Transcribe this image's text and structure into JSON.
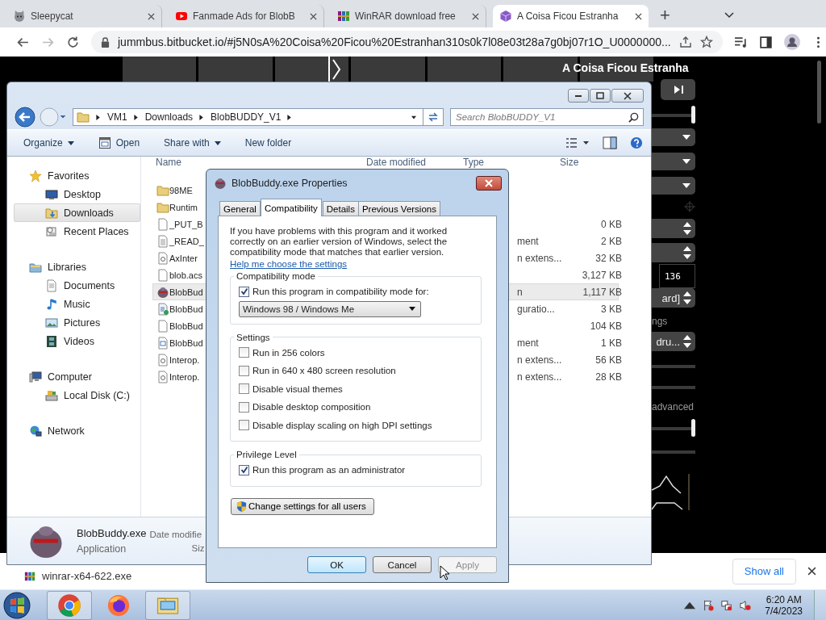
{
  "browser": {
    "tabs": [
      {
        "title": "Sleepycat",
        "kind": "cat",
        "selected": false
      },
      {
        "title": "Fanmade Ads for BlobB",
        "kind": "video",
        "selected": false
      },
      {
        "title": "WinRAR download free",
        "kind": "archive",
        "selected": false
      },
      {
        "title": "A Coisa Ficou Estranha",
        "kind": "cube",
        "selected": true
      }
    ],
    "new_tab": "+",
    "url": "jummbus.bitbucket.io/#j5N0sA%20Coisa%20Ficou%20Estranhan310s0k7l08e03t28a7g0bj07r1O_U0000000..."
  },
  "page": {
    "song_title": "A Coisa Ficou Estranha",
    "controls": [
      {
        "kind": "next-button"
      },
      {
        "kind": "slider",
        "level": 1
      },
      {
        "kind": "dropdown"
      },
      {
        "kind": "dropdown"
      },
      {
        "kind": "dropdown"
      },
      {
        "kind": "crosshair"
      },
      {
        "kind": "spinner"
      },
      {
        "kind": "spinner"
      },
      {
        "kind": "number",
        "value": "136"
      },
      {
        "kind": "spinner",
        "value": "ard]"
      },
      {
        "kind": "label",
        "value": "ngs"
      },
      {
        "kind": "spinner",
        "value": "dru..."
      },
      {
        "kind": "track"
      },
      {
        "kind": "track"
      },
      {
        "kind": "label",
        "value": "advanced"
      },
      {
        "kind": "slider",
        "level": 1
      },
      {
        "kind": "track"
      },
      {
        "kind": "envelope"
      }
    ]
  },
  "explorer": {
    "breadcrumb": [
      "VM1",
      "Downloads",
      "BlobBUDDY_V1"
    ],
    "search": {
      "placeholder": "Search BlobBUDDY_V1"
    },
    "toolbar": [
      {
        "label": "Organize",
        "kind": "menu"
      },
      {
        "label": "Open",
        "kind": "open"
      },
      {
        "label": "Share with",
        "kind": "menu"
      },
      {
        "label": "New folder",
        "kind": "plain"
      }
    ],
    "nav": [
      {
        "label": "Favorites",
        "kind": "star",
        "selected": false,
        "children": [
          {
            "label": "Desktop",
            "kind": "monitor",
            "selected": false
          },
          {
            "label": "Downloads",
            "kind": "downloads",
            "selected": true
          },
          {
            "label": "Recent Places",
            "kind": "recent",
            "selected": false
          }
        ]
      },
      {
        "label": "Libraries",
        "kind": "library",
        "selected": false,
        "children": [
          {
            "label": "Documents",
            "kind": "document",
            "selected": false
          },
          {
            "label": "Music",
            "kind": "music",
            "selected": false
          },
          {
            "label": "Pictures",
            "kind": "pictures",
            "selected": false
          },
          {
            "label": "Videos",
            "kind": "video",
            "selected": false
          }
        ]
      },
      {
        "label": "Computer",
        "kind": "computer",
        "selected": false,
        "children": [
          {
            "label": "Local Disk (C:)",
            "kind": "disk",
            "selected": false
          }
        ]
      },
      {
        "label": "Network",
        "kind": "network",
        "selected": false
      }
    ],
    "columns": [
      "Name",
      "Date modified",
      "Type",
      "Size"
    ],
    "files": [
      {
        "name": "98ME",
        "kind": "folder",
        "selected": false
      },
      {
        "name": "Runtim",
        "kind": "folder",
        "selected": false
      },
      {
        "name": "_PUT_B",
        "kind": "file",
        "size": "0 KB",
        "selected": false
      },
      {
        "name": "_READ_",
        "kind": "text",
        "type": "ment",
        "size": "2 KB",
        "selected": false
      },
      {
        "name": "AxInter",
        "kind": "dll",
        "type": "n extens...",
        "size": "32 KB",
        "selected": false
      },
      {
        "name": "blob.acs",
        "kind": "file",
        "size": "3,127 KB",
        "selected": false
      },
      {
        "name": "BlobBud",
        "kind": "app",
        "type": "n",
        "size": "1,117 KB",
        "selected": true
      },
      {
        "name": "BlobBud",
        "kind": "config",
        "type": "guratio...",
        "size": "3 KB",
        "selected": false
      },
      {
        "name": "BlobBud",
        "kind": "file",
        "size": "104 KB",
        "selected": false
      },
      {
        "name": "BlobBud",
        "kind": "xml",
        "type": "ment",
        "size": "1 KB",
        "selected": false
      },
      {
        "name": "Interop.",
        "kind": "dll",
        "type": "n extens...",
        "size": "56 KB",
        "selected": false
      },
      {
        "name": "Interop.",
        "kind": "dll",
        "type": "n extens...",
        "size": "28 KB",
        "selected": false
      }
    ],
    "details": {
      "name": "BlobBuddy.exe",
      "type": "Application",
      "field_1": "Date modifie",
      "field_2": "Siz"
    }
  },
  "dialog": {
    "title": "BlobBuddy.exe Properties",
    "tabs": [
      {
        "label": "General",
        "selected": false
      },
      {
        "label": "Compatibility",
        "selected": true
      },
      {
        "label": "Details",
        "selected": false
      },
      {
        "label": "Previous Versions",
        "selected": false
      }
    ],
    "intro": "If you have problems with this program and it worked correctly on an earlier version of Windows, select the compatibility mode that matches that earlier version.",
    "help_link": "Help me choose the settings",
    "groups": [
      {
        "title": "Compatibility mode",
        "options": [
          {
            "label": "Run this program in compatibility mode for:",
            "checked": true
          }
        ],
        "select": "Windows 98 / Windows Me"
      },
      {
        "title": "Settings",
        "options": [
          {
            "label": "Run in 256 colors",
            "checked": false
          },
          {
            "label": "Run in 640 x 480 screen resolution",
            "checked": false
          },
          {
            "label": "Disable visual themes",
            "checked": false
          },
          {
            "label": "Disable desktop composition",
            "checked": false
          },
          {
            "label": "Disable display scaling on high DPI settings",
            "checked": false
          }
        ]
      },
      {
        "title": "Privilege Level",
        "options": [
          {
            "label": "Run this program as an administrator",
            "checked": true
          }
        ]
      }
    ],
    "all_users_button": "Change settings for all users",
    "buttons": [
      {
        "label": "OK",
        "disabled": false
      },
      {
        "label": "Cancel",
        "disabled": false
      },
      {
        "label": "Apply",
        "disabled": true
      }
    ]
  },
  "downloads": {
    "file": "winrar-x64-622.exe",
    "show_all": "Show all"
  },
  "taskbar": {
    "apps": [
      {
        "kind": "chrome",
        "selected": true
      },
      {
        "kind": "firefox",
        "selected": false
      },
      {
        "kind": "explorer",
        "selected": true
      }
    ],
    "time": "6:20 AM",
    "date": "7/4/2023"
  }
}
